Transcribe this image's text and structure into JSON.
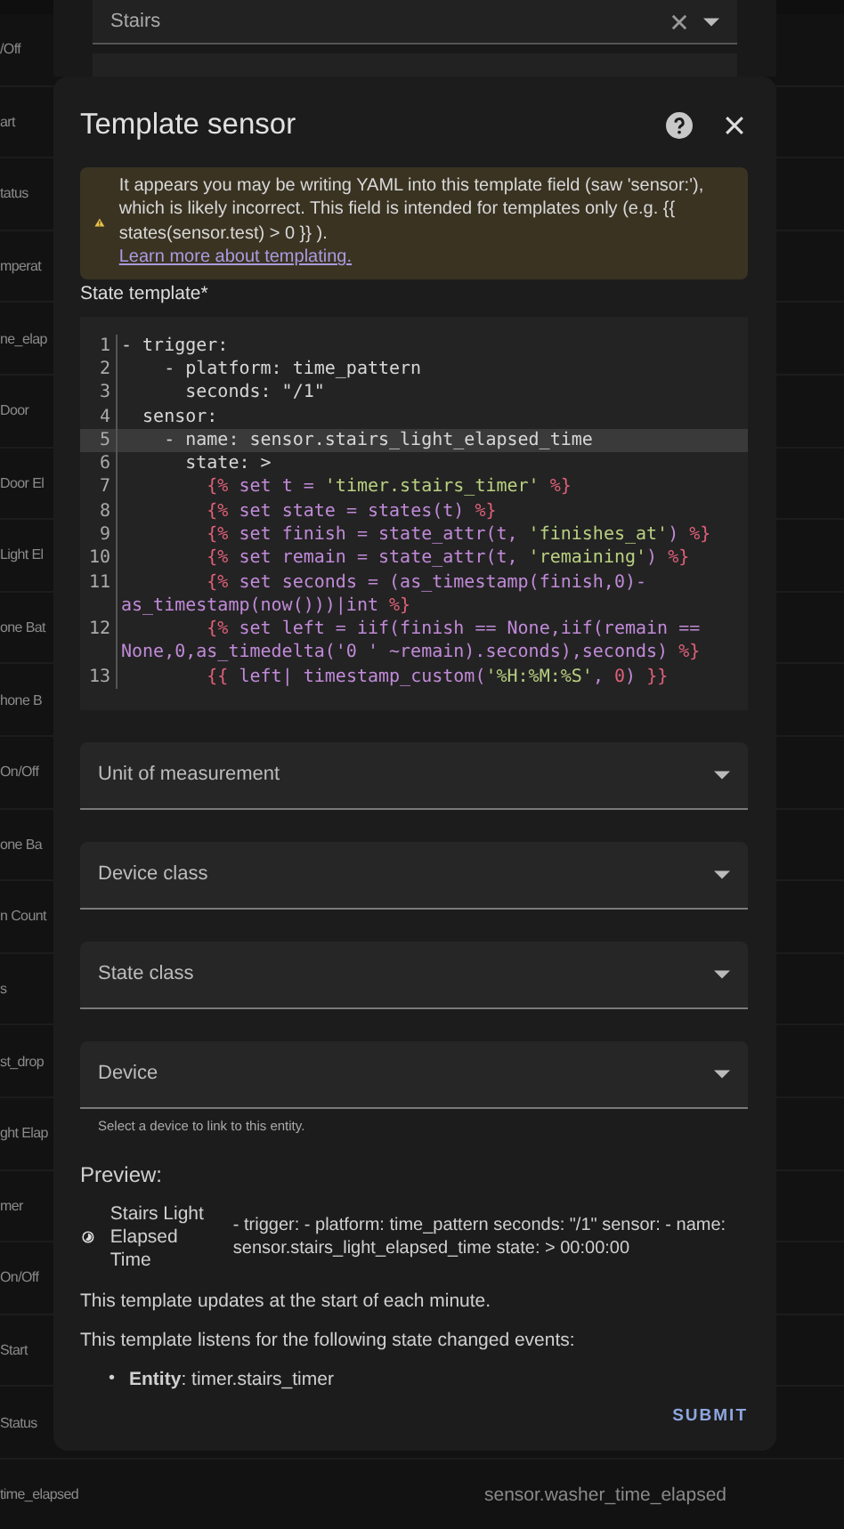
{
  "background_list": {
    "rows": [
      {
        "column_1": "/Off"
      },
      {
        "column_1": "art"
      },
      {
        "column_1": "tatus"
      },
      {
        "column_1": "mperat"
      },
      {
        "column_1": "ne_elap"
      },
      {
        "column_1": "Door"
      },
      {
        "column_1": "Door El"
      },
      {
        "column_1": "Light El"
      },
      {
        "column_1": "one Bat"
      },
      {
        "column_1": "hone B"
      },
      {
        "column_1": "On/Off"
      },
      {
        "column_1": "one Ba"
      },
      {
        "column_1": "n Count"
      },
      {
        "column_1": "s"
      },
      {
        "column_1": "st_drop"
      },
      {
        "column_1": "ght Elap"
      },
      {
        "column_1": "mer"
      },
      {
        "column_1": "On/Off"
      },
      {
        "column_1": "Start"
      },
      {
        "column_1": "Status"
      },
      {
        "column_1": "time_elapsed",
        "column_2": "sensor.washer_time_elapsed"
      }
    ]
  },
  "area_field": {
    "value": "Stairs"
  },
  "dialog": {
    "title": "Template sensor",
    "warning": {
      "text": "It appears you may be writing YAML into this template field (saw 'sensor:'), which is likely incorrect. This field is intended for templates only (e.g. {{ states(sensor.test) > 0 }} ).",
      "link": "Learn more about templating."
    },
    "template_label": "State template*",
    "code": [
      {
        "number": "1",
        "active": false,
        "rows": [
          [
            {
              "t": "- trigger:",
              "color": "#d6d6d6"
            }
          ]
        ]
      },
      {
        "number": "2",
        "active": false,
        "rows": [
          [
            {
              "t": "    - platform: time_pattern",
              "color": "#d6d6d6"
            }
          ]
        ]
      },
      {
        "number": "3",
        "active": false,
        "rows": [
          [
            {
              "t": "      seconds: \"/1\"",
              "color": "#d6d6d6"
            }
          ]
        ]
      },
      {
        "number": "4",
        "active": false,
        "rows": [
          [
            {
              "t": "  sensor:",
              "color": "#d6d6d6"
            }
          ]
        ]
      },
      {
        "number": "5",
        "active": true,
        "rows": [
          [
            {
              "t": "    - name: sensor.stairs_light_elapsed_time",
              "color": "#d6d6d6"
            }
          ]
        ]
      },
      {
        "number": "6",
        "active": false,
        "rows": [
          [
            {
              "t": "      state: >",
              "color": "#d6d6d6"
            }
          ]
        ]
      },
      {
        "number": "7",
        "active": false,
        "rows": [
          [
            {
              "t": "        {%",
              "color": "#e0607a"
            },
            {
              "t": " set t = ",
              "color": "#c08ad8"
            },
            {
              "t": "'timer.stairs_timer'",
              "color": "#b8d080"
            },
            {
              "t": " %}",
              "color": "#e0607a"
            }
          ]
        ]
      },
      {
        "number": "8",
        "active": false,
        "rows": [
          [
            {
              "t": "        {%",
              "color": "#e0607a"
            },
            {
              "t": " set state = states(t) ",
              "color": "#c08ad8"
            },
            {
              "t": "%}",
              "color": "#e0607a"
            }
          ]
        ]
      },
      {
        "number": "9",
        "active": false,
        "rows": [
          [
            {
              "t": "        {%",
              "color": "#e0607a"
            },
            {
              "t": " set finish = state_attr(t, ",
              "color": "#c08ad8"
            },
            {
              "t": "'finishes_at'",
              "color": "#b8d080"
            },
            {
              "t": ") ",
              "color": "#c08ad8"
            },
            {
              "t": "%}",
              "color": "#e0607a"
            }
          ]
        ]
      },
      {
        "number": "10",
        "active": false,
        "rows": [
          [
            {
              "t": "        {%",
              "color": "#e0607a"
            },
            {
              "t": " set remain = state_attr(t, ",
              "color": "#c08ad8"
            },
            {
              "t": "'remaining'",
              "color": "#b8d080"
            },
            {
              "t": ") ",
              "color": "#c08ad8"
            },
            {
              "t": "%}",
              "color": "#e0607a"
            }
          ]
        ]
      },
      {
        "number": "11",
        "active": false,
        "rows": [
          [
            {
              "t": "        {%",
              "color": "#e0607a"
            },
            {
              "t": " set seconds = (as_timestamp(finish,0)-",
              "color": "#c08ad8"
            }
          ],
          [
            {
              "t": "as_timestamp(now()))|int ",
              "color": "#c08ad8"
            },
            {
              "t": "%}",
              "color": "#e0607a"
            }
          ]
        ]
      },
      {
        "number": "12",
        "active": false,
        "rows": [
          [
            {
              "t": "        {%",
              "color": "#e0607a"
            },
            {
              "t": " set left = iif(finish == None,iif(remain ==",
              "color": "#c08ad8"
            }
          ],
          [
            {
              "t": "None,0,as_timedelta('0 ' ~remain).seconds),seconds) ",
              "color": "#c08ad8"
            },
            {
              "t": "%}",
              "color": "#e0607a"
            }
          ]
        ]
      },
      {
        "number": "13",
        "active": false,
        "rows": [
          [
            {
              "t": "        {{",
              "color": "#e0607a"
            },
            {
              "t": " left| timestamp_custom(",
              "color": "#c08ad8"
            },
            {
              "t": "'%H:%M:%S'",
              "color": "#b8d080"
            },
            {
              "t": ", ",
              "color": "#c08ad8"
            },
            {
              "t": "0",
              "color": "#e0607a"
            },
            {
              "t": ") ",
              "color": "#c08ad8"
            },
            {
              "t": "}}",
              "color": "#e0607a"
            }
          ]
        ]
      }
    ],
    "selects": [
      {
        "label": "Unit of measurement"
      },
      {
        "label": "Device class"
      },
      {
        "label": "State class"
      },
      {
        "label": "Device",
        "helper": "Select a device to link to this entity."
      }
    ],
    "preview": {
      "heading": "Preview:",
      "entity_name": "Stairs Light Elapsed Time",
      "entity_state": "- trigger: - platform: time_pattern seconds: \"/1\" sensor: - name: sensor.stairs_light_elapsed_time state: > 00:00:00",
      "notes": [
        "This template updates at the start of each minute.",
        "This template listens for the following state changed events:"
      ],
      "listeners": [
        {
          "bullet": "•",
          "text": "**Entity**: timer.stairs_timer"
        }
      ]
    },
    "submit": "SUBMIT"
  }
}
